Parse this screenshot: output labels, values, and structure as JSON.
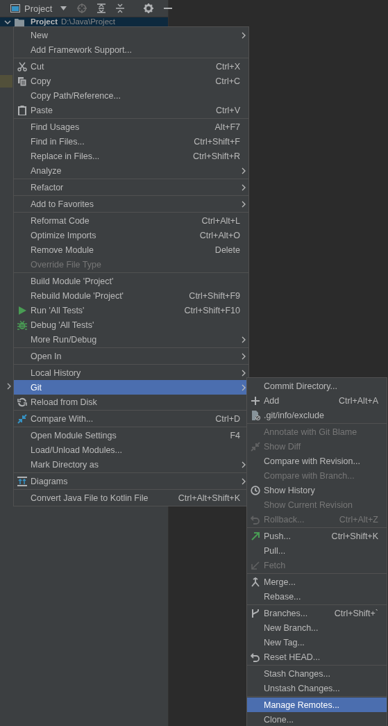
{
  "tool_window": {
    "title": "Project"
  },
  "tree": {
    "root": {
      "name": "Project",
      "path": "D:\\Java\\Project",
      "expanded": true,
      "selected": true
    }
  },
  "context_menu": {
    "groups": [
      [
        {
          "label": "New",
          "kind": "plain",
          "submenu": true,
          "disabled": false,
          "selected": false
        },
        {
          "label": "Add Framework Support...",
          "kind": "plain",
          "submenu": false,
          "disabled": false,
          "selected": false
        }
      ],
      [
        {
          "label": "Cut",
          "kind": "scissors",
          "shortcut": "Ctrl+X",
          "submenu": false,
          "disabled": false,
          "selected": false
        },
        {
          "label": "Copy",
          "kind": "copy",
          "shortcut": "Ctrl+C",
          "submenu": false,
          "disabled": false,
          "selected": false
        },
        {
          "label": "Copy Path/Reference...",
          "kind": "plain",
          "submenu": false,
          "disabled": false,
          "selected": false
        },
        {
          "label": "Paste",
          "kind": "clipboard",
          "shortcut": "Ctrl+V",
          "submenu": false,
          "disabled": false,
          "selected": false
        }
      ],
      [
        {
          "label": "Find Usages",
          "kind": "plain",
          "shortcut": "Alt+F7",
          "submenu": false,
          "disabled": false,
          "selected": false
        },
        {
          "label": "Find in Files...",
          "kind": "plain",
          "shortcut": "Ctrl+Shift+F",
          "submenu": false,
          "disabled": false,
          "selected": false
        },
        {
          "label": "Replace in Files...",
          "kind": "plain",
          "shortcut": "Ctrl+Shift+R",
          "submenu": false,
          "disabled": false,
          "selected": false
        },
        {
          "label": "Analyze",
          "kind": "plain",
          "submenu": true,
          "disabled": false,
          "selected": false
        }
      ],
      [
        {
          "label": "Refactor",
          "kind": "plain",
          "submenu": true,
          "disabled": false,
          "selected": false
        }
      ],
      [
        {
          "label": "Add to Favorites",
          "kind": "plain",
          "submenu": true,
          "disabled": false,
          "selected": false
        }
      ],
      [
        {
          "label": "Reformat Code",
          "kind": "plain",
          "shortcut": "Ctrl+Alt+L",
          "submenu": false,
          "disabled": false,
          "selected": false
        },
        {
          "label": "Optimize Imports",
          "kind": "plain",
          "shortcut": "Ctrl+Alt+O",
          "submenu": false,
          "disabled": false,
          "selected": false
        },
        {
          "label": "Remove Module",
          "kind": "plain",
          "shortcut": "Delete",
          "submenu": false,
          "disabled": false,
          "selected": false
        },
        {
          "label": "Override File Type",
          "kind": "plain",
          "submenu": false,
          "disabled": true,
          "selected": false
        }
      ],
      [
        {
          "label": "Build Module 'Project'",
          "kind": "plain",
          "submenu": false,
          "disabled": false,
          "selected": false
        },
        {
          "label": "Rebuild Module 'Project'",
          "kind": "plain",
          "shortcut": "Ctrl+Shift+F9",
          "submenu": false,
          "disabled": false,
          "selected": false
        },
        {
          "label": "Run 'All Tests'",
          "kind": "play",
          "shortcut": "Ctrl+Shift+F10",
          "submenu": false,
          "disabled": false,
          "selected": false
        },
        {
          "label": "Debug 'All Tests'",
          "kind": "bug",
          "submenu": false,
          "disabled": false,
          "selected": false
        },
        {
          "label": "More Run/Debug",
          "kind": "plain",
          "submenu": true,
          "disabled": false,
          "selected": false
        }
      ],
      [
        {
          "label": "Open In",
          "kind": "plain",
          "submenu": true,
          "disabled": false,
          "selected": false
        }
      ],
      [
        {
          "label": "Local History",
          "kind": "plain",
          "submenu": true,
          "disabled": false,
          "selected": false
        },
        {
          "label": "Git",
          "kind": "plain",
          "submenu": true,
          "disabled": false,
          "selected": true
        },
        {
          "label": "Reload from Disk",
          "kind": "refresh",
          "submenu": false,
          "disabled": false,
          "selected": false
        }
      ],
      [
        {
          "label": "Compare With...",
          "kind": "compare",
          "shortcut": "Ctrl+D",
          "submenu": false,
          "disabled": false,
          "selected": false
        }
      ],
      [
        {
          "label": "Open Module Settings",
          "kind": "plain",
          "shortcut": "F4",
          "submenu": false,
          "disabled": false,
          "selected": false
        },
        {
          "label": "Load/Unload Modules...",
          "kind": "plain",
          "submenu": false,
          "disabled": false,
          "selected": false
        },
        {
          "label": "Mark Directory as",
          "kind": "plain",
          "submenu": true,
          "disabled": false,
          "selected": false
        }
      ],
      [
        {
          "label": "Diagrams",
          "kind": "diagram",
          "submenu": true,
          "disabled": false,
          "selected": false
        }
      ],
      [
        {
          "label": "Convert Java File to Kotlin File",
          "kind": "plain",
          "shortcut": "Ctrl+Alt+Shift+K",
          "submenu": false,
          "disabled": false,
          "selected": false
        }
      ]
    ]
  },
  "git_submenu": {
    "groups": [
      [
        {
          "label": "Commit Directory...",
          "kind": "plain",
          "submenu": false,
          "disabled": false,
          "selected": false
        },
        {
          "label": "Add",
          "kind": "plus",
          "shortcut": "Ctrl+Alt+A",
          "submenu": false,
          "disabled": false,
          "selected": false
        },
        {
          "label": ".git/info/exclude",
          "kind": "ignored-file",
          "submenu": false,
          "disabled": false,
          "selected": false
        }
      ],
      [
        {
          "label": "Annotate with Git Blame",
          "kind": "plain",
          "submenu": false,
          "disabled": true,
          "selected": false
        },
        {
          "label": "Show Diff",
          "kind": "compare",
          "submenu": false,
          "disabled": true,
          "selected": false
        },
        {
          "label": "Compare with Revision...",
          "kind": "plain",
          "submenu": false,
          "disabled": false,
          "selected": false
        },
        {
          "label": "Compare with Branch...",
          "kind": "plain",
          "submenu": false,
          "disabled": true,
          "selected": false
        },
        {
          "label": "Show History",
          "kind": "clock",
          "submenu": false,
          "disabled": false,
          "selected": false
        },
        {
          "label": "Show Current Revision",
          "kind": "plain",
          "submenu": false,
          "disabled": true,
          "selected": false
        },
        {
          "label": "Rollback...",
          "kind": "undo",
          "shortcut": "Ctrl+Alt+Z",
          "submenu": false,
          "disabled": true,
          "selected": false
        }
      ],
      [
        {
          "label": "Push...",
          "kind": "push",
          "shortcut": "Ctrl+Shift+K",
          "submenu": false,
          "disabled": false,
          "selected": false
        },
        {
          "label": "Pull...",
          "kind": "plain",
          "submenu": false,
          "disabled": false,
          "selected": false
        },
        {
          "label": "Fetch",
          "kind": "fetch",
          "submenu": false,
          "disabled": true,
          "selected": false
        }
      ],
      [
        {
          "label": "Merge...",
          "kind": "merge",
          "submenu": false,
          "disabled": false,
          "selected": false
        },
        {
          "label": "Rebase...",
          "kind": "plain",
          "submenu": false,
          "disabled": false,
          "selected": false
        }
      ],
      [
        {
          "label": "Branches...",
          "kind": "branch",
          "shortcut": "Ctrl+Shift+`",
          "submenu": false,
          "disabled": false,
          "selected": false
        },
        {
          "label": "New Branch...",
          "kind": "plain",
          "submenu": false,
          "disabled": false,
          "selected": false
        },
        {
          "label": "New Tag...",
          "kind": "plain",
          "submenu": false,
          "disabled": false,
          "selected": false
        },
        {
          "label": "Reset HEAD...",
          "kind": "undo",
          "submenu": false,
          "disabled": false,
          "selected": false
        }
      ],
      [
        {
          "label": "Stash Changes...",
          "kind": "plain",
          "submenu": false,
          "disabled": false,
          "selected": false
        },
        {
          "label": "Unstash Changes...",
          "kind": "plain",
          "submenu": false,
          "disabled": false,
          "selected": false
        }
      ],
      [
        {
          "label": "Manage Remotes...",
          "kind": "plain",
          "submenu": false,
          "disabled": false,
          "selected": true
        },
        {
          "label": "Clone...",
          "kind": "plain",
          "submenu": false,
          "disabled": false,
          "selected": false
        }
      ]
    ]
  }
}
